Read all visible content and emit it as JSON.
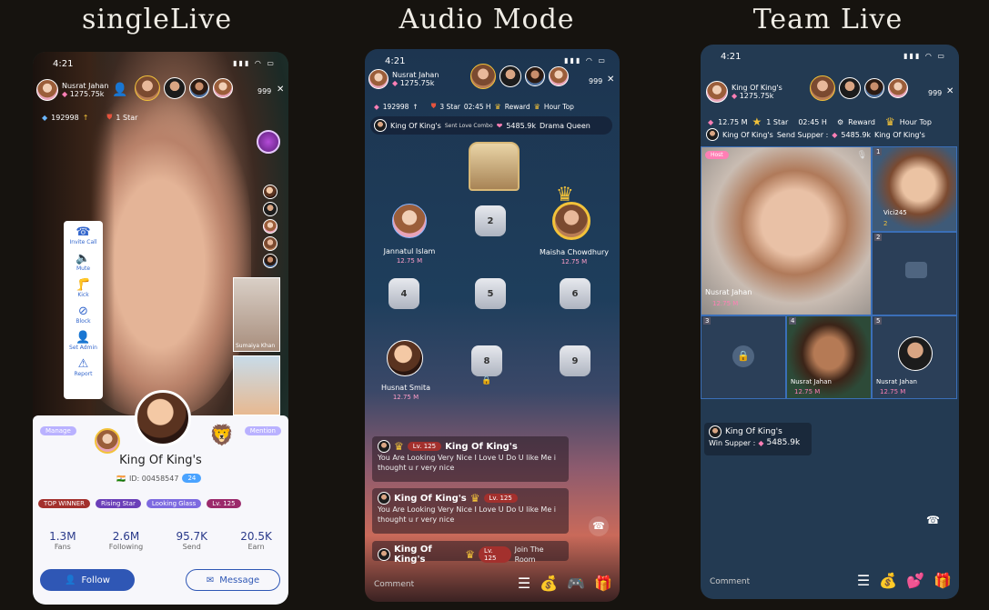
{
  "titles": {
    "single": "singleLive",
    "audio": "Audio Mode",
    "team": "Team Live"
  },
  "status_time": "4:21",
  "icons": {
    "signal": "signal-icon",
    "wifi": "wifi-icon",
    "battery": "battery-icon",
    "close": "close-icon",
    "diamond": "diamond-icon",
    "crown": "crown-icon"
  },
  "single": {
    "host_name": "Nusrat Jahan",
    "host_score": "1275.75k",
    "viewer_count": "999",
    "diamonds": "192998",
    "star": "1 Star",
    "side_menu": [
      {
        "label": "Invite Call",
        "icon": "phone-icon"
      },
      {
        "label": "Mute",
        "icon": "speaker-icon"
      },
      {
        "label": "Kick",
        "icon": "kick-icon"
      },
      {
        "label": "Block",
        "icon": "block-icon"
      },
      {
        "label": "Set Admin",
        "icon": "admin-icon"
      },
      {
        "label": "Report",
        "icon": "report-icon"
      }
    ],
    "pip_name": "Sumaiya Khan",
    "profile": {
      "manage": "Manage",
      "mention": "Mention",
      "name": "King Of King's",
      "id": "ID: 00458547",
      "level_badge": "24",
      "badges": [
        "TOP WINNER",
        "Rising Star",
        "Looking Glass",
        "Lv. 125"
      ],
      "stats": [
        {
          "value": "1.3M",
          "label": "Fans"
        },
        {
          "value": "2.6M",
          "label": "Following"
        },
        {
          "value": "95.7K",
          "label": "Send"
        },
        {
          "value": "20.5K",
          "label": "Earn"
        }
      ],
      "follow": "Follow",
      "message": "Message"
    }
  },
  "audio": {
    "host_name": "Nusrat Jahan",
    "host_score": "1275.75k",
    "viewer_count": "999",
    "diamonds": "192998",
    "star": "3 Star",
    "timer": "02:45 H",
    "reward": "Reward",
    "hour_top": "Hour Top",
    "banner_name": "King Of King's",
    "banner_action": "Sent Love Combo",
    "banner_value": "5485.9k",
    "banner_target": "Drama Queen",
    "seats": [
      {
        "name": "Jannatul Islam",
        "value": "12.75 M"
      },
      {
        "num": "2"
      },
      {
        "name": "Maisha Chowdhury",
        "value": "12.75 M"
      },
      {
        "num": "4"
      },
      {
        "num": "5"
      },
      {
        "num": "6"
      },
      {
        "name": "Husnat Smita",
        "value": "12.75 M"
      },
      {
        "num": "8"
      },
      {
        "num": "9"
      }
    ],
    "chats": [
      {
        "name": "King Of King's",
        "level": "Lv. 125",
        "text": "You Are Looking Very Nice I Love U  Do U like Me i thought u r very nice"
      },
      {
        "name": "King Of King's",
        "level": "Lv. 125",
        "text": "You Are Looking Very Nice I Love U  Do U like Me i thought u r very nice"
      },
      {
        "name": "King Of King's",
        "level": "Lv. 125",
        "text": "Join The Room"
      }
    ],
    "comment": "Comment"
  },
  "team": {
    "host_name": "King Of King's",
    "host_score": "1275.75k",
    "viewer_count": "999",
    "diamonds": "12.75 M",
    "star": "1 Star",
    "timer": "02:45 H",
    "reward": "Reward",
    "hour_top": "Hour Top",
    "banner_name": "King Of King's",
    "banner_action": "Send Supper :",
    "banner_value": "5485.9k",
    "banner_target": "King Of King's",
    "host_tag": "Host",
    "main_name": "Nusrat Jahan",
    "main_value": "12.75 M",
    "cell1_name": "Vici245",
    "cell1_num": "1",
    "cell1_val": "2",
    "cell2_num": "2",
    "cell3_num": "3",
    "cell4_num": "4",
    "cell4_name": "Nusrat Jahan",
    "cell4_value": "12.75 M",
    "cell5_num": "5",
    "cell5_name": "Nusrat Jahan",
    "cell5_value": "12.75 M",
    "chat_name": "King Of King's",
    "chat_text": "Win Supper :",
    "chat_value": "5485.9k",
    "comment": "Comment"
  }
}
